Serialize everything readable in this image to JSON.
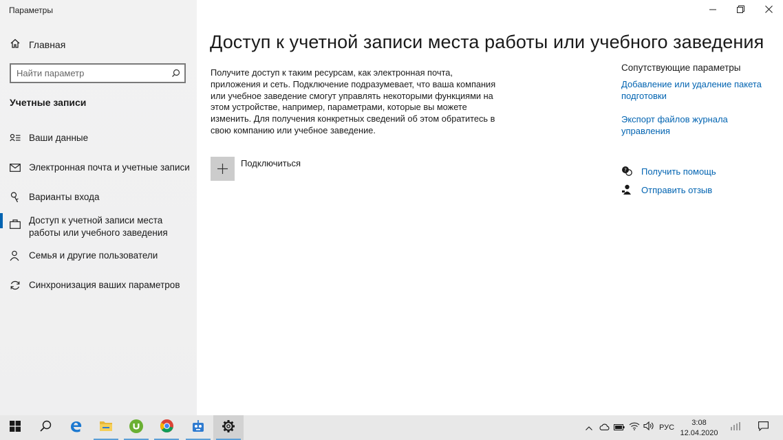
{
  "window": {
    "title": "Параметры",
    "controls": [
      "minimize",
      "restore",
      "close"
    ]
  },
  "sidebar": {
    "home_label": "Главная",
    "search_placeholder": "Найти параметр",
    "section_title": "Учетные записи",
    "items": [
      {
        "label": "Ваши данные",
        "icon": "person-card-icon"
      },
      {
        "label": "Электронная почта и учетные записи",
        "icon": "mail-icon"
      },
      {
        "label": "Варианты входа",
        "icon": "key-icon"
      },
      {
        "label": "Доступ к учетной записи места работы или учебного заведения",
        "icon": "briefcase-icon",
        "active": true
      },
      {
        "label": "Семья и другие пользователи",
        "icon": "people-icon"
      },
      {
        "label": "Синхронизация ваших параметров",
        "icon": "sync-icon"
      }
    ]
  },
  "main": {
    "title": "Доступ к учетной записи места работы или учебного заведения",
    "description": "Получите доступ к таким ресурсам, как электронная почта, приложения и сеть. Подключение подразумевает, что ваша компания или учебное заведение смогут управлять некоторыми функциями на этом устройстве, например, параметрами, которые вы можете изменить. Для получения конкретных сведений об этом обратитесь в свою компанию или учебное заведение.",
    "connect_label": "Подключиться"
  },
  "related": {
    "title": "Сопутствующие параметры",
    "links": [
      "Добавление или удаление пакета подготовки",
      "Экспорт файлов журнала управления"
    ],
    "help_label": "Получить помощь",
    "feedback_label": "Отправить отзыв"
  },
  "taskbar": {
    "apps": [
      "start-icon",
      "search-icon",
      "edge-icon",
      "file-explorer-icon",
      "utorrent-icon",
      "chrome-icon",
      "app-icon",
      "settings-icon"
    ],
    "language": "РУС",
    "time": "3:08",
    "date": "12.04.2020"
  },
  "colors": {
    "accent": "#0063b1",
    "sidebar_bg": "#f2f2f2",
    "taskbar_bg": "#e8e8e8"
  }
}
